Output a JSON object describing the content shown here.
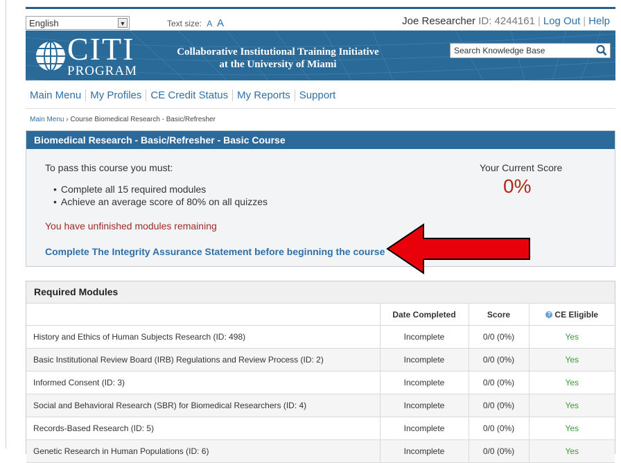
{
  "topbar": {
    "language": "English",
    "text_size_label": "Text size:",
    "text_size_small": "A",
    "text_size_large": "A",
    "user_name": "Joe Researcher",
    "id_label": "ID: 4244161",
    "logout": "Log Out",
    "help": "Help"
  },
  "banner": {
    "logo_main": "CITI",
    "logo_sub": "PROGRAM",
    "title_line1": "Collaborative Institutional Training Initiative",
    "title_line2": "at the University of Miami",
    "search_placeholder": "Search Knowledge Base"
  },
  "nav": [
    "Main Menu",
    "My Profiles",
    "CE Credit Status",
    "My Reports",
    "Support"
  ],
  "breadcrumb": {
    "link": "Main Menu",
    "separator": "›",
    "current": "Course Biomedical Research - Basic/Refresher"
  },
  "course": {
    "title": "Biomedical Research - Basic/Refresher - Basic Course",
    "requirements_label": "To pass this course you must:",
    "requirements": [
      "Complete all 15 required modules",
      "Achieve an average score of 80% on all quizzes"
    ],
    "score_label": "Your Current Score",
    "score_value": "0%",
    "unfinished_notice": "You have unfinished modules remaining",
    "integrity_link": "Complete The Integrity Assurance Statement before beginning the course"
  },
  "modules": {
    "heading": "Required Modules",
    "columns": [
      "",
      "Date Completed",
      "Score",
      "CE Eligible"
    ],
    "rows": [
      {
        "name": "History and Ethics of Human Subjects Research (ID: 498)",
        "date": "Incomplete",
        "score": "0/0 (0%)",
        "ce": "Yes"
      },
      {
        "name": "Basic Institutional Review Board (IRB) Regulations and Review Process (ID: 2)",
        "date": "Incomplete",
        "score": "0/0 (0%)",
        "ce": "Yes"
      },
      {
        "name": "Informed Consent (ID: 3)",
        "date": "Incomplete",
        "score": "0/0 (0%)",
        "ce": "Yes"
      },
      {
        "name": "Social and Behavioral Research (SBR) for Biomedical Researchers (ID: 4)",
        "date": "Incomplete",
        "score": "0/0 (0%)",
        "ce": "Yes"
      },
      {
        "name": "Records-Based Research (ID: 5)",
        "date": "Incomplete",
        "score": "0/0 (0%)",
        "ce": "Yes"
      },
      {
        "name": "Genetic Research in Human Populations (ID: 6)",
        "date": "Incomplete",
        "score": "0/0 (0%)",
        "ce": "Yes"
      }
    ]
  },
  "colors": {
    "brand_blue": "#2a6a99",
    "link_blue": "#2f6fa6",
    "score_red": "#b02a1c",
    "arrow_red": "#e8000b",
    "yes_green": "#3a9a3a"
  }
}
